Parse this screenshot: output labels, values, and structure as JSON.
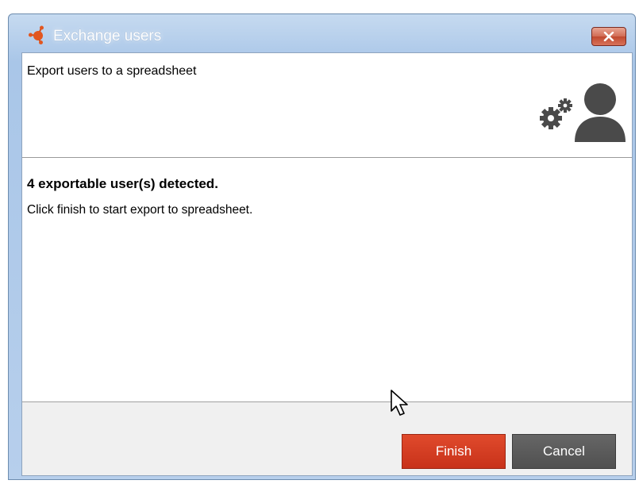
{
  "window": {
    "title": "Exchange users",
    "app_icon": "network-nodes-icon",
    "close_icon": "close-icon"
  },
  "header": {
    "title": "Export users to a spreadsheet",
    "icon": "user-settings-icon"
  },
  "body": {
    "detected_text": "4 exportable user(s) detected.",
    "instruction_text": "Click finish to start export to spreadsheet."
  },
  "footer": {
    "finish_label": "Finish",
    "cancel_label": "Cancel"
  },
  "colors": {
    "finish_button": "#d23d22",
    "cancel_button": "#5a5a5a",
    "titlebar": "#b7cfec",
    "icon_gray": "#4a4a4a"
  }
}
